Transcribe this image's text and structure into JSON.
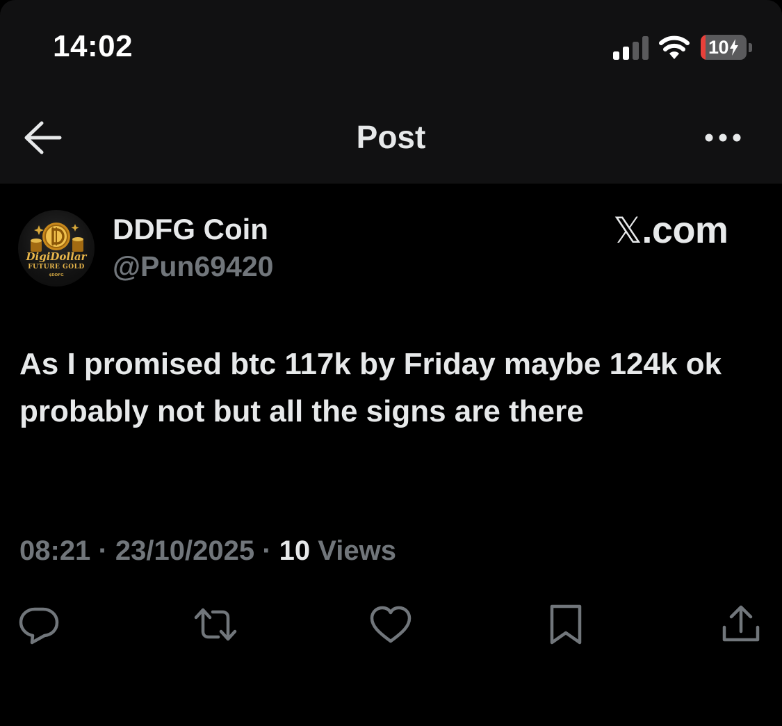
{
  "status_bar": {
    "time": "14:02",
    "battery_level": 10,
    "battery_label": "10",
    "battery_charging": true,
    "icons": [
      "signal-icon",
      "wifi-icon",
      "battery-icon",
      "charging-bolt-icon"
    ]
  },
  "nav": {
    "title": "Post",
    "back_icon": "arrow-left-icon",
    "more_icon": "more-horizontal-icon"
  },
  "post": {
    "author_name": "DDFG Coin",
    "author_handle": "@Pun69420",
    "avatar": {
      "line1": "DigiDollar",
      "line2": "FUTURE GOLD",
      "line3": "$DDFG"
    },
    "watermark_x": "𝕏",
    "watermark_domain": ".com",
    "text": "As I promised btc 117k by Friday maybe 124k ok probably not but all the signs are there",
    "time": "08:21",
    "separator": "·",
    "date": "23/10/2025",
    "views_count": "10",
    "views_label": "Views"
  },
  "actions": [
    {
      "name": "reply",
      "icon": "reply-icon"
    },
    {
      "name": "repost",
      "icon": "repost-icon"
    },
    {
      "name": "like",
      "icon": "heart-icon"
    },
    {
      "name": "bookmark",
      "icon": "bookmark-icon"
    },
    {
      "name": "share",
      "icon": "share-icon"
    }
  ],
  "colors": {
    "background": "#000000",
    "bar_background": "#111112",
    "primary_text": "#e7e9ea",
    "secondary_text": "#71767b",
    "battery_low": "#e8403a"
  }
}
